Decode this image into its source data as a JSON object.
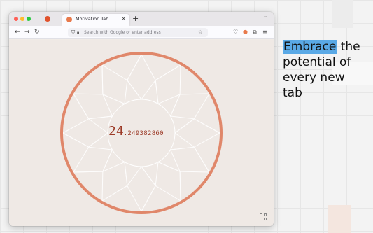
{
  "browser": {
    "tab_title": "Motivation Tab",
    "tab_close_icon": "×",
    "new_tab_icon": "+",
    "tab_list_icon": "⌄",
    "url_placeholder": "Search with Google or enter address"
  },
  "content": {
    "age_integer": "24",
    "age_decimal": ".249382860"
  },
  "tagline": {
    "highlight": "Embrace",
    "line1_rest": " the",
    "line2": "potential of",
    "line3": "every new",
    "line4": "tab"
  },
  "colors": {
    "ring": "#e0876a",
    "age_text": "#9c3a27",
    "highlight": "#5aa9e6",
    "page_bg": "#efe9e5"
  }
}
